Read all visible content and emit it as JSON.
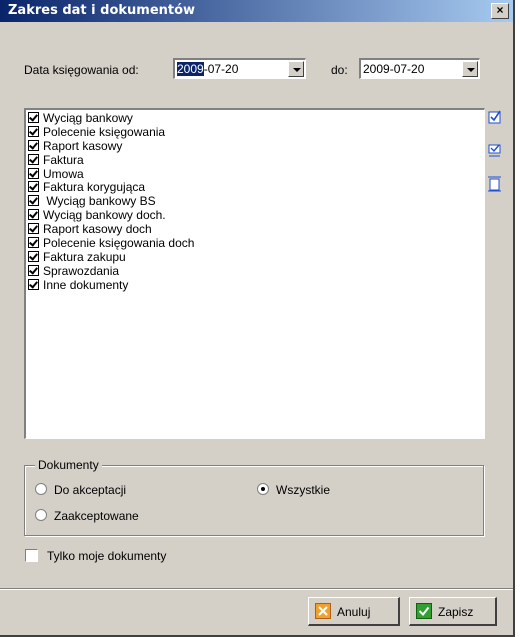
{
  "window": {
    "title": "Zakres dat i dokumentów",
    "close_glyph": "×"
  },
  "dates": {
    "from_label": "Data księgowania od:",
    "from_value_selected": "2009",
    "from_value_rest": "-07-20",
    "to_label": "do:",
    "to_value": "2009-07-20"
  },
  "documents": {
    "items": [
      {
        "label": "Wyciąg bankowy",
        "checked": true
      },
      {
        "label": "Polecenie księgowania",
        "checked": true
      },
      {
        "label": "Raport kasowy",
        "checked": true
      },
      {
        "label": "Faktura",
        "checked": true
      },
      {
        "label": "Umowa",
        "checked": true
      },
      {
        "label": "Faktura korygująca",
        "checked": true
      },
      {
        "label": " Wyciąg bankowy BS",
        "checked": true
      },
      {
        "label": "Wyciąg bankowy doch.",
        "checked": true
      },
      {
        "label": "Raport kasowy doch",
        "checked": true
      },
      {
        "label": "Polecenie księgowania doch",
        "checked": true
      },
      {
        "label": "Faktura zakupu",
        "checked": true
      },
      {
        "label": "Sprawozdania",
        "checked": true
      },
      {
        "label": "Inne dokumenty",
        "checked": true
      }
    ],
    "side_icons": [
      "select-all-icon",
      "select-toggle-icon",
      "deselect-all-icon"
    ]
  },
  "filter": {
    "group_title": "Dokumenty",
    "options": [
      {
        "label": "Do akceptacji",
        "selected": false
      },
      {
        "label": "Wszystkie",
        "selected": true
      },
      {
        "label": "Zaakceptowane",
        "selected": false
      }
    ],
    "only_mine_label": "Tylko moje dokumenty",
    "only_mine_checked": false
  },
  "buttons": {
    "cancel_label": "Anuluj",
    "save_label": "Zapisz"
  },
  "colors": {
    "title_bar_start": "#0a246a",
    "title_bar_end": "#a6caf0",
    "cancel_icon": "#f0a030",
    "save_icon": "#30a030",
    "side_icon": "#2050d0"
  }
}
